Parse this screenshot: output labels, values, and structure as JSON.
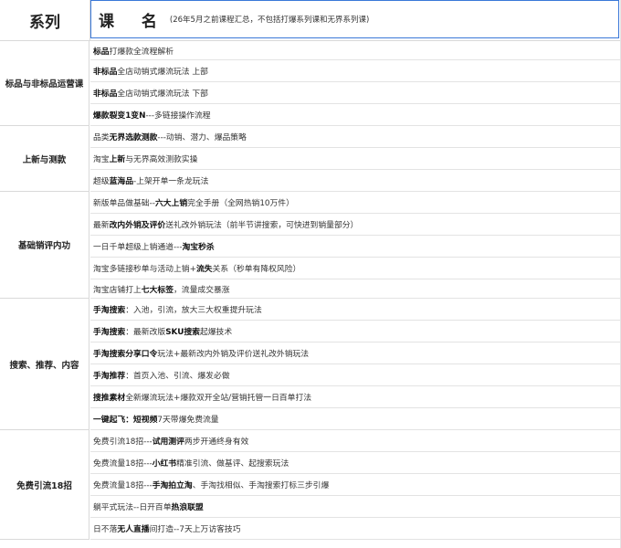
{
  "header": {
    "series_label": "系列",
    "course_label": "课 名",
    "course_note": "(26年5月之前课程汇总，不包括打爆系列课和无界系列课)"
  },
  "categories": [
    {
      "name": "标品与非标品运营课",
      "rows": [
        [
          {
            "t": "标品",
            "b": true
          },
          {
            "t": "打爆款全流程解析"
          }
        ],
        [
          {
            "t": "非标品",
            "b": true
          },
          {
            "t": "全店动销式爆流玩法   上部"
          }
        ],
        [
          {
            "t": "非标品",
            "b": true
          },
          {
            "t": "全店动销式爆流玩法    下部"
          }
        ],
        [
          {
            "t": "爆款裂变1变N",
            "b": true
          },
          {
            "t": "---多链接操作流程"
          }
        ]
      ]
    },
    {
      "name": "上新与测款",
      "rows": [
        [
          {
            "t": "品类"
          },
          {
            "t": "无界选款测款",
            "b": true
          },
          {
            "t": "---动销、潜力、爆品策略"
          }
        ],
        [
          {
            "t": "淘宝"
          },
          {
            "t": "上新",
            "b": true
          },
          {
            "t": "与无界高效测款实操"
          }
        ],
        [
          {
            "t": "超级"
          },
          {
            "t": "蓝海品",
            "b": true
          },
          {
            "t": "-上架开单一条龙玩法"
          }
        ]
      ]
    },
    {
      "name": "基础销评内功",
      "rows": [
        [
          {
            "t": "新版单品做基础--"
          },
          {
            "t": "六大上销",
            "b": true
          },
          {
            "t": "完全手册（全网热销10万件）"
          }
        ],
        [
          {
            "t": "最新"
          },
          {
            "t": "改内外销及评价",
            "b": true
          },
          {
            "t": "送礼改外销玩法（前半节讲搜索，可快进到销量部分）"
          }
        ],
        [
          {
            "t": "一日千单超级上销通道---"
          },
          {
            "t": "淘宝秒杀",
            "b": true
          }
        ],
        [
          {
            "t": "淘宝多链接秒单与活动上销+"
          },
          {
            "t": "流失",
            "b": true
          },
          {
            "t": "关系（秒单有降权风险）"
          }
        ],
        [
          {
            "t": "淘宝店铺打上"
          },
          {
            "t": "七大标签",
            "b": true
          },
          {
            "t": "，流量成交暴涨"
          }
        ]
      ]
    },
    {
      "name": "搜索、推荐、内容",
      "rows": [
        [
          {
            "t": "手淘搜索",
            "b": true
          },
          {
            "t": "：入池，引流，放大三大权重提升玩法"
          }
        ],
        [
          {
            "t": "手淘搜索",
            "b": true
          },
          {
            "t": "：最新改版"
          },
          {
            "t": "SKU搜索",
            "b": true
          },
          {
            "t": "起爆技术"
          }
        ],
        [
          {
            "t": "手淘搜索分享口令",
            "b": true
          },
          {
            "t": "玩法+最新改内外销及评价送礼改外销玩法"
          }
        ],
        [
          {
            "t": "手淘推荐",
            "b": true
          },
          {
            "t": "：首页入池、引流、爆发必做"
          }
        ],
        [
          {
            "t": "搜推素材",
            "b": true
          },
          {
            "t": "全新爆流玩法+爆款双开全站/营销托管一日百单打法"
          }
        ],
        [
          {
            "t": "一键起飞",
            "b": true
          },
          {
            "t": "：短视频",
            "b": true
          },
          {
            "t": "7天带爆免费流量"
          }
        ]
      ]
    },
    {
      "name": "免费引流18招",
      "rows": [
        [
          {
            "t": "免费引流18招---"
          },
          {
            "t": "试用测评",
            "b": true
          },
          {
            "t": "两步开通终身有效"
          }
        ],
        [
          {
            "t": "免费流量18招---"
          },
          {
            "t": "小红书",
            "b": true
          },
          {
            "t": "精准引流、做基评、起搜索玩法"
          }
        ],
        [
          {
            "t": "免费流量18招---"
          },
          {
            "t": "手淘拍立淘",
            "b": true
          },
          {
            "t": "、手淘找相似、手淘搜索打标三步引爆"
          }
        ],
        [
          {
            "t": "躺平式玩法--日开百单"
          },
          {
            "t": "热浪联盟",
            "b": true
          }
        ],
        [
          {
            "t": "日不落"
          },
          {
            "t": "无人直播",
            "b": true
          },
          {
            "t": "间打造--7天上万访客技巧"
          }
        ]
      ]
    }
  ]
}
